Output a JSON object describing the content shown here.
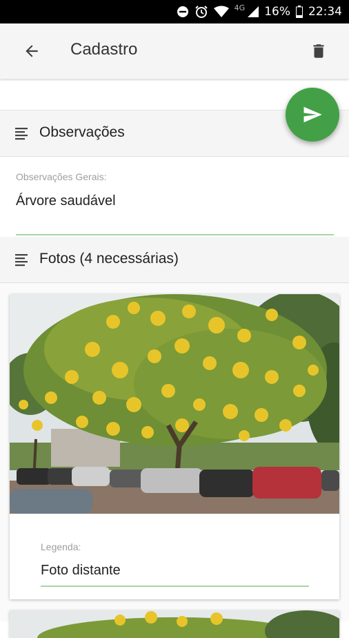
{
  "status_bar": {
    "network": "4G",
    "battery": "16%",
    "time": "22:34",
    "icons": [
      "dnd-icon",
      "alarm-icon",
      "wifi-icon",
      "signal-icon",
      "battery-icon"
    ]
  },
  "app_bar": {
    "title": "Cadastro",
    "back_icon": "arrow-back-icon",
    "delete_icon": "trash-icon"
  },
  "fab": {
    "icon": "send-icon",
    "color": "#43a047"
  },
  "sections": {
    "observacoes": {
      "title": "Observações",
      "icon": "notes-icon",
      "field_label": "Observações Gerais:",
      "field_value": "Árvore saudável"
    },
    "fotos": {
      "title": "Fotos (4 necessárias)",
      "icon": "notes-icon",
      "cards": [
        {
          "caption_label": "Legenda:",
          "caption_value": "Foto distante"
        }
      ]
    }
  },
  "colors": {
    "accent": "#43a047",
    "underline": "#a5d6a7",
    "header_bg": "#f5f5f5",
    "status_bar": "#000000"
  }
}
